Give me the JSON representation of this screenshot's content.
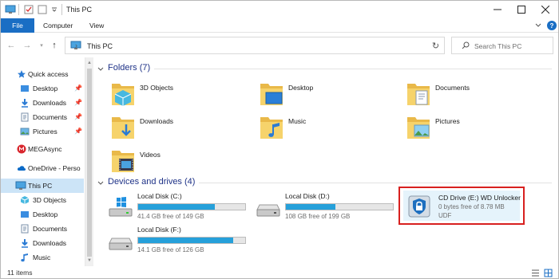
{
  "window": {
    "title": "This PC"
  },
  "ribbon": {
    "tabs": [
      "File",
      "Computer",
      "View"
    ],
    "help_label": "?"
  },
  "address": {
    "path": "This PC",
    "search_placeholder": "Search This PC"
  },
  "nav_pane": {
    "items": [
      {
        "label": "Quick access",
        "icon": "star-icon",
        "pinned": false
      },
      {
        "label": "Desktop",
        "icon": "desktop-icon",
        "pinned": true
      },
      {
        "label": "Downloads",
        "icon": "download-arrow-icon",
        "pinned": true
      },
      {
        "label": "Documents",
        "icon": "documents-icon",
        "pinned": true
      },
      {
        "label": "Pictures",
        "icon": "pictures-icon",
        "pinned": true
      },
      {
        "label": "MEGAsync",
        "icon": "mega-icon",
        "pinned": false
      },
      {
        "label": "OneDrive - Perso",
        "icon": "cloud-icon",
        "pinned": false
      },
      {
        "label": "This PC",
        "icon": "computer-icon",
        "pinned": false,
        "selected": true
      },
      {
        "label": "3D Objects",
        "icon": "cube-icon",
        "pinned": false
      },
      {
        "label": "Desktop",
        "icon": "desktop-icon",
        "pinned": false
      },
      {
        "label": "Documents",
        "icon": "documents-icon",
        "pinned": false
      },
      {
        "label": "Downloads",
        "icon": "download-arrow-icon",
        "pinned": false
      },
      {
        "label": "Music",
        "icon": "music-note-icon",
        "pinned": false
      }
    ]
  },
  "folders": {
    "header": "Folders (7)",
    "items": [
      {
        "name": "3D Objects",
        "icon": "cube-folder-icon"
      },
      {
        "name": "Desktop",
        "icon": "desktop-folder-icon"
      },
      {
        "name": "Documents",
        "icon": "documents-folder-icon"
      },
      {
        "name": "Downloads",
        "icon": "downloads-folder-icon"
      },
      {
        "name": "Music",
        "icon": "music-folder-icon"
      },
      {
        "name": "Pictures",
        "icon": "pictures-folder-icon"
      },
      {
        "name": "Videos",
        "icon": "videos-folder-icon"
      }
    ]
  },
  "drives": {
    "header": "Devices and drives (4)",
    "items": [
      {
        "name": "Local Disk (C:)",
        "free": "41.4 GB free of 149 GB",
        "used_fraction": 0.72,
        "icon": "windows-drive-icon"
      },
      {
        "name": "Local Disk (D:)",
        "free": "108 GB free of 199 GB",
        "used_fraction": 0.46,
        "icon": "hard-drive-icon"
      },
      {
        "name": "Local Disk (F:)",
        "free": "14.1 GB free of 126 GB",
        "used_fraction": 0.89,
        "icon": "hard-drive-icon"
      }
    ],
    "cd": {
      "name": "CD Drive (E:) WD Unlocker",
      "free": "0 bytes free of 8.78 MB",
      "filesystem": "UDF",
      "icon": "locked-drive-icon"
    }
  },
  "status": {
    "item_count": "11 items"
  },
  "colors": {
    "accent": "#1a6ec4",
    "drive_bar": "#26a0da",
    "header_text": "#1e3287",
    "highlight_border": "#d8201f",
    "selected_bg": "#cce4f7",
    "folder_yellow": "#f2c94c"
  }
}
